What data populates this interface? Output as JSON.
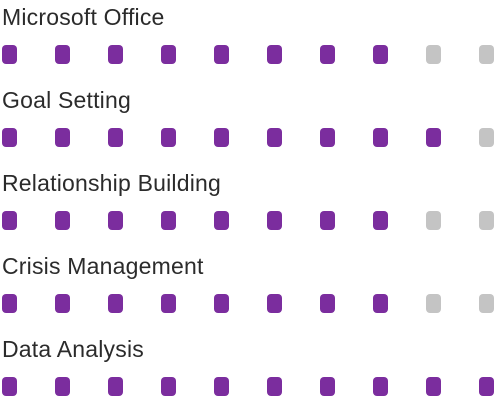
{
  "colors": {
    "filled": "#7b2d9e",
    "empty": "#c4c4c4"
  },
  "skills": [
    {
      "name": "Microsoft Office",
      "level": 8,
      "max": 10
    },
    {
      "name": "Goal Setting",
      "level": 9,
      "max": 10
    },
    {
      "name": "Relationship Building",
      "level": 8,
      "max": 10
    },
    {
      "name": "Crisis Management",
      "level": 8,
      "max": 10
    },
    {
      "name": "Data Analysis",
      "level": 10,
      "max": 10
    }
  ]
}
